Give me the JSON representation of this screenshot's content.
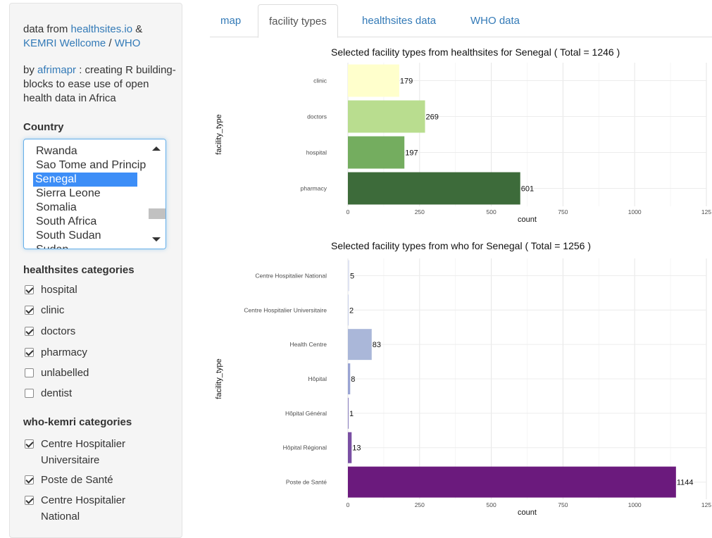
{
  "sidebar": {
    "intro1": {
      "text1": "data from ",
      "link1": "healthsites.io",
      "text2": " & ",
      "link2": "KEMRI Wellcome",
      "text3": " / ",
      "link3": "WHO"
    },
    "intro2": {
      "link": "afrimapr",
      "pre": "by ",
      "text": " : creating R building-blocks to ease use of open health data in Africa"
    },
    "country_label": "Country",
    "country_options": [
      "Rwanda",
      "Sao Tome and Princip",
      "Senegal",
      "Sierra Leone",
      "Somalia",
      "South Africa",
      "South Sudan",
      "Sudan"
    ],
    "country_selected": "Senegal",
    "hs_label": "healthsites categories",
    "hs_categories": [
      {
        "label": "hospital",
        "checked": true
      },
      {
        "label": "clinic",
        "checked": true
      },
      {
        "label": "doctors",
        "checked": true
      },
      {
        "label": "pharmacy",
        "checked": true
      },
      {
        "label": "unlabelled",
        "checked": false
      },
      {
        "label": "dentist",
        "checked": false
      }
    ],
    "who_label": "who-kemri categories",
    "who_categories": [
      {
        "label": "Centre Hospitalier Universitaire",
        "checked": true
      },
      {
        "label": "Poste de Santé",
        "checked": true
      },
      {
        "label": "Centre Hospitalier National",
        "checked": true
      }
    ]
  },
  "tabs": [
    "map",
    "facility types",
    "healthsites data",
    "WHO data"
  ],
  "active_tab": "facility types",
  "chart_data": [
    {
      "type": "bar",
      "orientation": "horizontal",
      "title": "Selected facility types from healthsites for Senegal ( Total = 1246 )",
      "xlabel": "count",
      "ylabel": "facility_type",
      "xlim": [
        0,
        1250
      ],
      "xticks": [
        "0",
        "250",
        "500",
        "750",
        "1000",
        "125"
      ],
      "categories": [
        "clinic",
        "doctors",
        "hospital",
        "pharmacy"
      ],
      "values": [
        179,
        269,
        197,
        601
      ],
      "colors": [
        "#ffffcc",
        "#b9dd8f",
        "#74ad5f",
        "#3d6b3a"
      ],
      "grid": true
    },
    {
      "type": "bar",
      "orientation": "horizontal",
      "title": "Selected facility types from who for Senegal ( Total = 1256 )",
      "xlabel": "count",
      "ylabel": "facility_type",
      "xlim": [
        0,
        1250
      ],
      "xticks": [
        "0",
        "250",
        "500",
        "750",
        "1000",
        "125"
      ],
      "categories": [
        "Centre Hospitalier National",
        "Centre Hospitalier Universitaire",
        "Health Centre",
        "Hôpital",
        "Hôpital Général",
        "Hôpital Régional",
        "Poste de Santé"
      ],
      "values": [
        5,
        2,
        83,
        8,
        1,
        13,
        1144
      ],
      "colors": [
        "#dfe3f2",
        "#c9d1ea",
        "#aab7d9",
        "#9aa4d3",
        "#8a7fc0",
        "#7a4fa3",
        "#6b1a7d"
      ],
      "grid": true
    }
  ]
}
